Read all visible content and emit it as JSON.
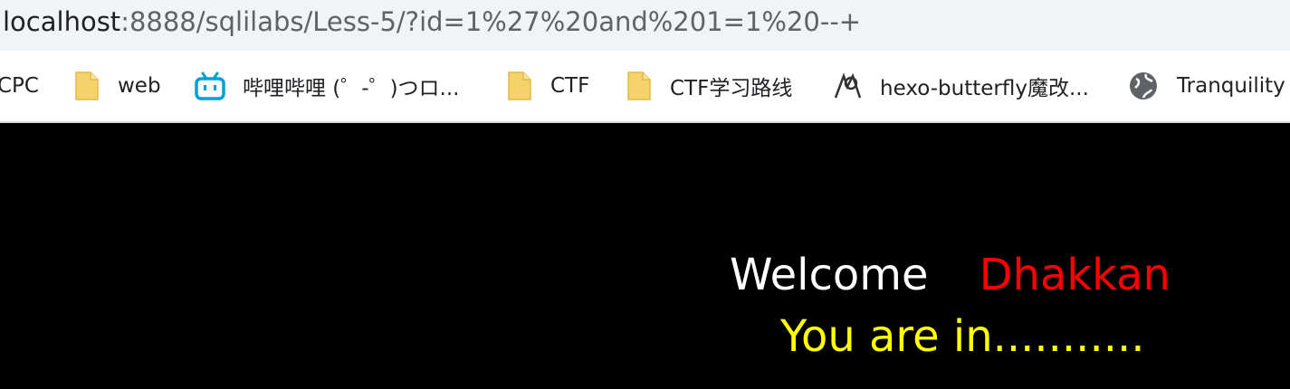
{
  "address_bar": {
    "host": "localhost",
    "rest": ":8888/sqlilabs/Less-5/?id=1%27%20and%201=1%20--+"
  },
  "bookmarks": [
    {
      "label": "CPC",
      "icon": "none"
    },
    {
      "label": "web",
      "icon": "folder-icon"
    },
    {
      "label": "哔哩哔哩 (゜-゜)つロ...",
      "icon": "bilibili-icon"
    },
    {
      "label": "CTF",
      "icon": "folder-icon"
    },
    {
      "label": "CTF学习路线",
      "icon": "folder-icon"
    },
    {
      "label": "hexo-butterfly魔改...",
      "icon": "site-logo-icon"
    },
    {
      "label": "Tranquility",
      "icon": "globe-icon"
    }
  ],
  "page": {
    "welcome": "Welcome",
    "name": "Dhakkan",
    "status": "You are in..........."
  },
  "colors": {
    "background": "#000000",
    "welcome": "#ffffff",
    "name": "#ff0000",
    "status": "#ffff00",
    "folder": "#f5d36a",
    "bilibili": "#00a1d6"
  }
}
